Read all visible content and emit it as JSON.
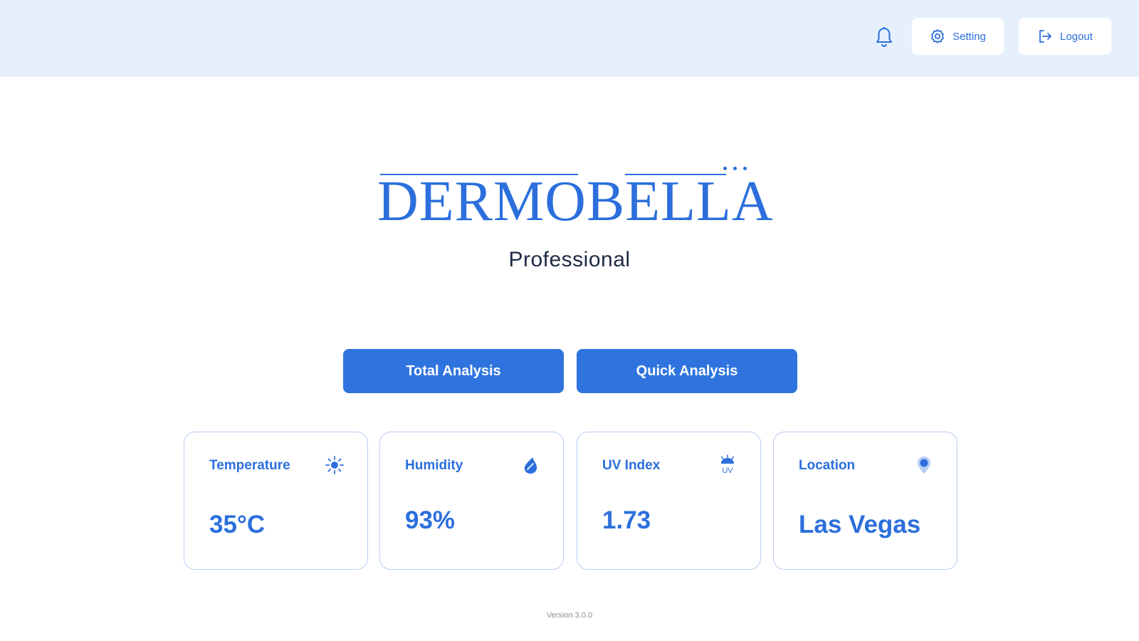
{
  "header": {
    "notification_icon": "bell-icon",
    "setting_label": "Setting",
    "setting_icon": "gear-icon",
    "logout_label": "Logout",
    "logout_icon": "logout-icon"
  },
  "brand": {
    "logo_text": "DERMOBELLA",
    "subtitle": "Professional"
  },
  "actions": {
    "total_label": "Total Analysis",
    "quick_label": "Quick Analysis"
  },
  "cards": [
    {
      "label": "Temperature",
      "value": "35°C",
      "icon": "sun-icon"
    },
    {
      "label": "Humidity",
      "value": "93%",
      "icon": "water-drop-icon"
    },
    {
      "label": "UV Index",
      "value": "1.73",
      "icon": "uv-icon",
      "icon_text": "UV"
    },
    {
      "label": "Location",
      "value": "Las Vegas",
      "icon": "location-pin-icon"
    }
  ],
  "footer": {
    "version": "Version 3.0.0"
  },
  "colors": {
    "accent": "#2f74de",
    "header_bg": "#e6f0fd",
    "card_border": "#b9cdf2",
    "title_text": "#1e2a44"
  }
}
